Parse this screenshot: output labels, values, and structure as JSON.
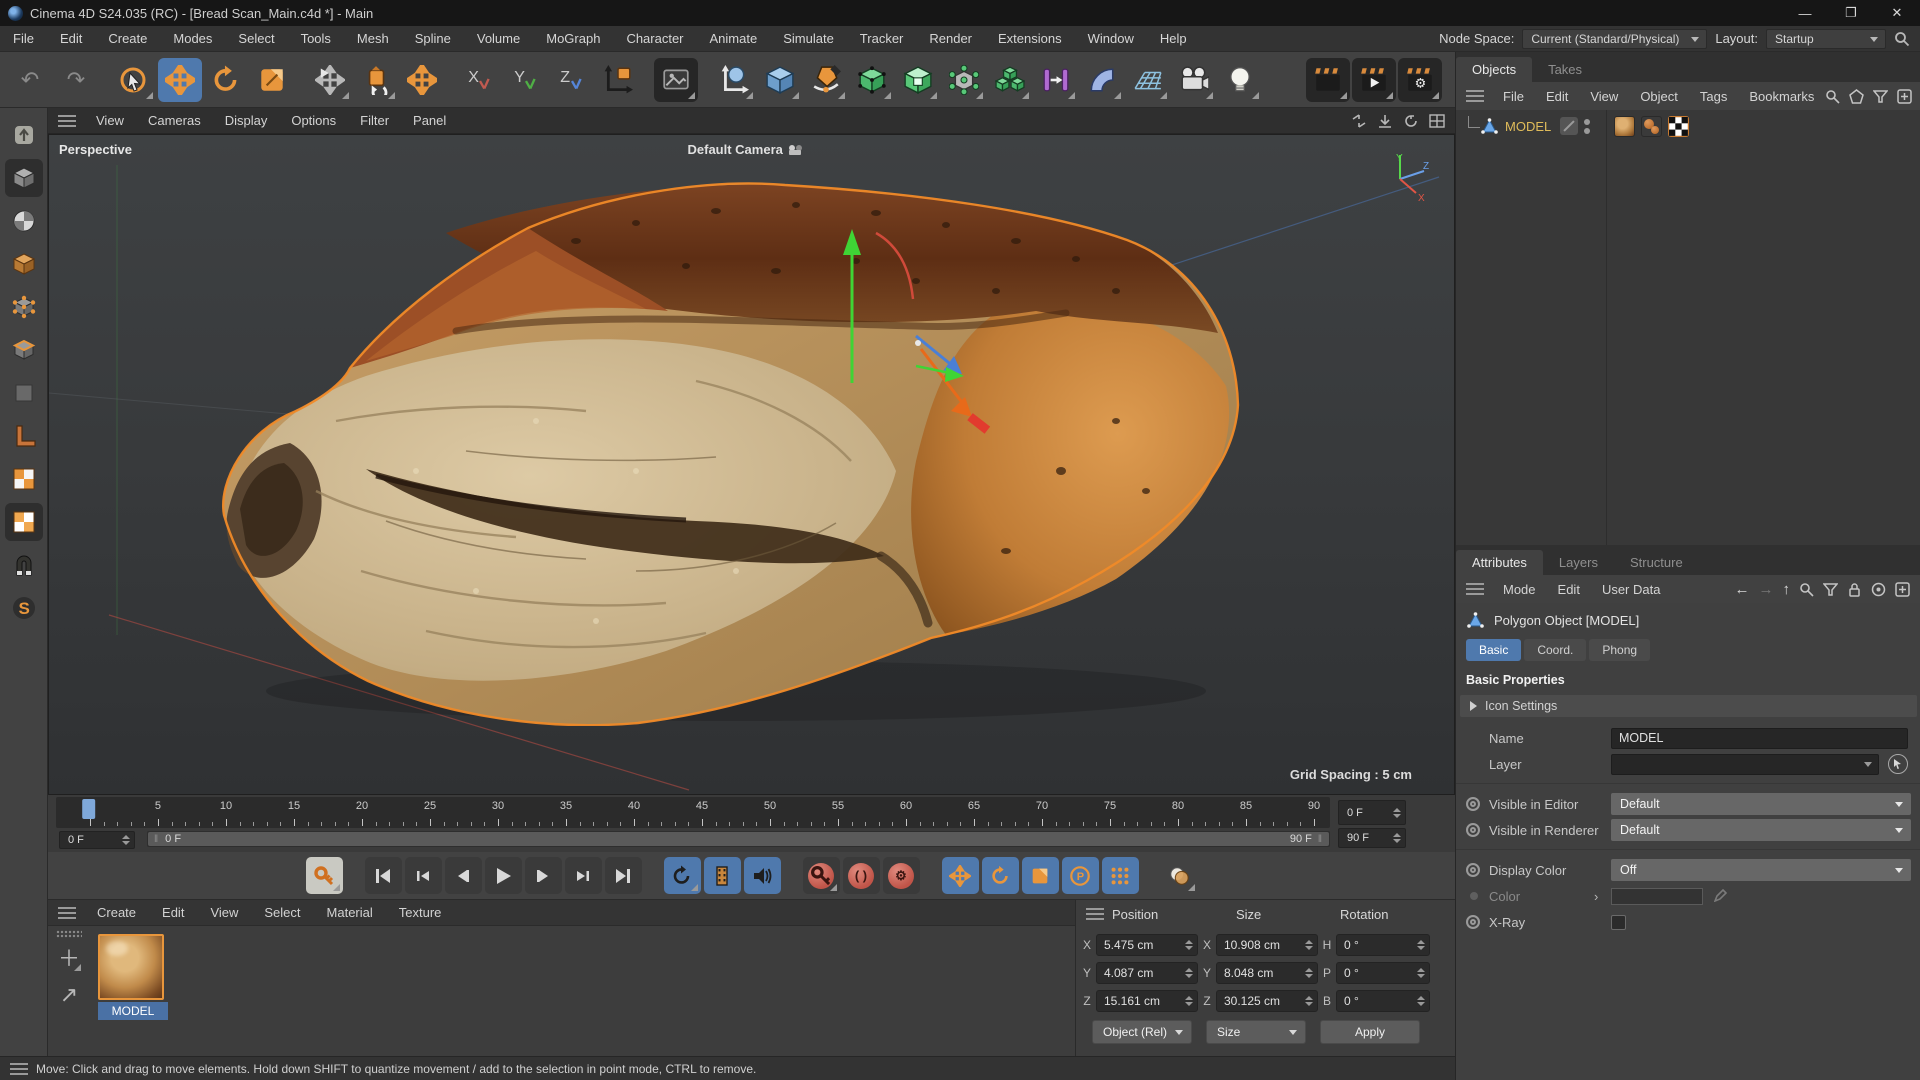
{
  "window": {
    "app_title": "Cinema 4D S24.035 (RC) - [Bread Scan_Main.c4d *] - Main"
  },
  "menu_bar": {
    "items": [
      "File",
      "Edit",
      "Create",
      "Modes",
      "Select",
      "Tools",
      "Mesh",
      "Spline",
      "Volume",
      "MoGraph",
      "Character",
      "Animate",
      "Simulate",
      "Tracker",
      "Render",
      "Extensions",
      "Window",
      "Help"
    ],
    "node_space_label": "Node Space:",
    "node_space_value": "Current (Standard/Physical)",
    "layout_label": "Layout:",
    "layout_value": "Startup"
  },
  "viewport": {
    "menu_items": [
      "View",
      "Cameras",
      "Display",
      "Options",
      "Filter",
      "Panel"
    ],
    "view_label": "Perspective",
    "camera_label": "Default Camera",
    "grid_spacing_label": "Grid Spacing : 5 cm",
    "axis_labels": {
      "x": "X",
      "y": "Y",
      "z": "Z"
    }
  },
  "timeline": {
    "start": 0,
    "end": 90,
    "label_step": 5,
    "current_frame": 0,
    "current_frame_field": "0 F",
    "range_start_field": "0 F",
    "range_end_field": "90 F",
    "scrollbar_left_label": "0 F",
    "scrollbar_right_label": "90 F"
  },
  "object_manager": {
    "tabs": [
      "Objects",
      "Takes"
    ],
    "active_tab": "Objects",
    "menu_items": [
      "File",
      "Edit",
      "View",
      "Object",
      "Tags",
      "Bookmarks"
    ],
    "objects": [
      {
        "name": "MODEL",
        "type": "Polygon Object",
        "tags": [
          "material",
          "phong",
          "uvw"
        ]
      }
    ]
  },
  "attribute_manager": {
    "tabs": [
      "Attributes",
      "Layers",
      "Structure"
    ],
    "active_tab": "Attributes",
    "menu_items": [
      "Mode",
      "Edit",
      "User Data"
    ],
    "object_title": "Polygon Object [MODEL]",
    "object_tabs": [
      "Basic",
      "Coord.",
      "Phong"
    ],
    "active_object_tab": "Basic",
    "section_header": "Basic Properties",
    "icon_settings_label": "Icon Settings",
    "fields": {
      "name_label": "Name",
      "name_value": "MODEL",
      "layer_label": "Layer",
      "visible_in_editor_label": "Visible in Editor",
      "visible_in_editor_value": "Default",
      "visible_in_renderer_label": "Visible in Renderer",
      "visible_in_renderer_value": "Default",
      "display_color_label": "Display Color",
      "display_color_value": "Off",
      "color_label": "Color",
      "xray_label": "X-Ray",
      "xray_checked": false
    }
  },
  "coordinate_manager": {
    "headers": {
      "position": "Position",
      "size": "Size",
      "rotation": "Rotation"
    },
    "rows": [
      {
        "pos_axis": "X",
        "pos_value": "5.475 cm",
        "size_axis": "X",
        "size_value": "10.908 cm",
        "rot_axis": "H",
        "rot_value": "0 °"
      },
      {
        "pos_axis": "Y",
        "pos_value": "4.087 cm",
        "size_axis": "Y",
        "size_value": "8.048 cm",
        "rot_axis": "P",
        "rot_value": "0 °"
      },
      {
        "pos_axis": "Z",
        "pos_value": "15.161 cm",
        "size_axis": "Z",
        "size_value": "30.125 cm",
        "rot_axis": "B",
        "rot_value": "0 °"
      }
    ],
    "mode_dropdown_value": "Object (Rel)",
    "size_dropdown_value": "Size",
    "apply_button_label": "Apply"
  },
  "material_manager": {
    "menu_items": [
      "Create",
      "Edit",
      "View",
      "Select",
      "Material",
      "Texture"
    ],
    "materials": [
      {
        "name": "MODEL",
        "selected": true
      }
    ]
  },
  "status_bar": {
    "message": "Move: Click and drag to move elements. Hold down SHIFT to quantize movement / add to the selection in point mode, CTRL to remove."
  },
  "colors": {
    "accent_orange": "#e8963c",
    "selection_blue": "#4f79ad",
    "object_name_yellow": "#e0bc5a",
    "record_red": "#c75a50",
    "axis_x_red": "#d8442e",
    "axis_y_green": "#3fd435",
    "axis_z_blue": "#4a7fd6"
  }
}
